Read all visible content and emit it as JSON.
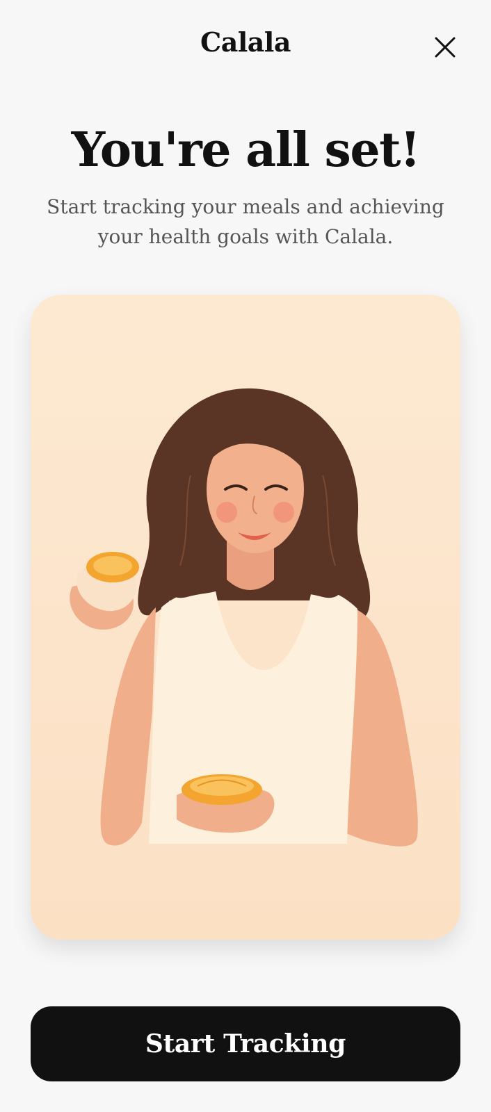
{
  "header": {
    "brand": "Calala",
    "close_icon": "close-icon"
  },
  "main": {
    "title": "You're all set!",
    "subtitle": "Start tracking your meals and achieving your health goals with Calala.",
    "illustration": {
      "icon": "woman-with-oranges-illustration",
      "background": "#fde9d2"
    }
  },
  "footer": {
    "cta_label": "Start Tracking"
  },
  "colors": {
    "background": "#f7f7f7",
    "cta_background": "#111111",
    "cta_text": "#ffffff",
    "title": "#111111",
    "subtitle": "#555555"
  }
}
